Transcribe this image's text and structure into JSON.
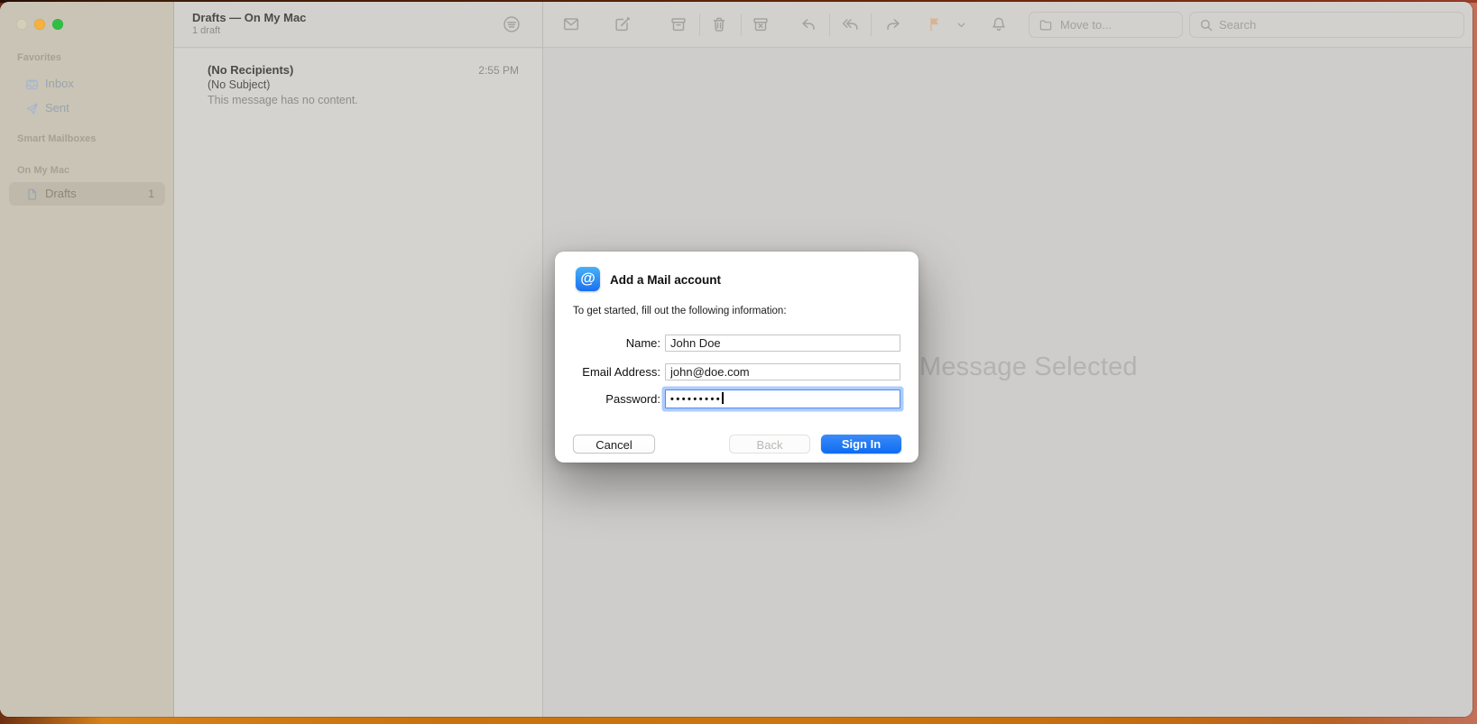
{
  "titlebar": {
    "title": "Drafts — On My Mac",
    "subtitle": "1 draft"
  },
  "toolbar": {
    "move_to_label": "Move to...",
    "search_placeholder": "Search",
    "icon_names": [
      "filter",
      "new-message",
      "compose",
      "archive",
      "trash",
      "junk",
      "reply",
      "reply-all",
      "forward",
      "flag",
      "flag-chevron",
      "mute-bell"
    ],
    "flag_color": "#dcb391"
  },
  "window_controls": {
    "close_color": "#d5cfba",
    "minimize_color": "#f6b23d",
    "zoom_color": "#2fc043"
  },
  "sidebar": {
    "sections": [
      {
        "header": "Favorites",
        "items": [
          {
            "label": "Inbox",
            "icon": "inbox-icon"
          },
          {
            "label": "Sent",
            "icon": "paperplane-icon"
          }
        ]
      },
      {
        "header": "Smart Mailboxes",
        "items": []
      },
      {
        "header": "On My Mac",
        "items": [
          {
            "label": "Drafts",
            "icon": "document-icon",
            "badge": "1",
            "selected": true
          }
        ]
      }
    ]
  },
  "message_list": {
    "items": [
      {
        "sender": "(No Recipients)",
        "time": "2:55 PM",
        "subject": "(No Subject)",
        "preview": "This message has no content."
      }
    ]
  },
  "message_view": {
    "placeholder": "No Message Selected"
  },
  "dialog": {
    "app_icon": "at-symbol-icon",
    "app_icon_glyph": "@",
    "title": "Add a Mail account",
    "subtitle": "To get started, fill out the following information:",
    "fields": [
      {
        "label": "Name:",
        "value": "John Doe",
        "type": "text"
      },
      {
        "label": "Email Address:",
        "value": "john@doe.com",
        "type": "text"
      },
      {
        "label": "Password:",
        "value": "•••••••••",
        "type": "password",
        "focused": true
      }
    ],
    "buttons": [
      {
        "label": "Cancel",
        "style": "default"
      },
      {
        "label": "Back",
        "style": "disabled"
      },
      {
        "label": "Sign In",
        "style": "primary"
      }
    ]
  },
  "colors": {
    "accent_blue": "#1873f4",
    "focus_ring": "#4c8df6",
    "sidebar_bg": "#cac4b6",
    "toolbar_bg": "#d2d1cd",
    "list_bg": "#d4d3cf",
    "view_bg": "#cecdcb",
    "wallpaper_orange": "#c9720f"
  }
}
